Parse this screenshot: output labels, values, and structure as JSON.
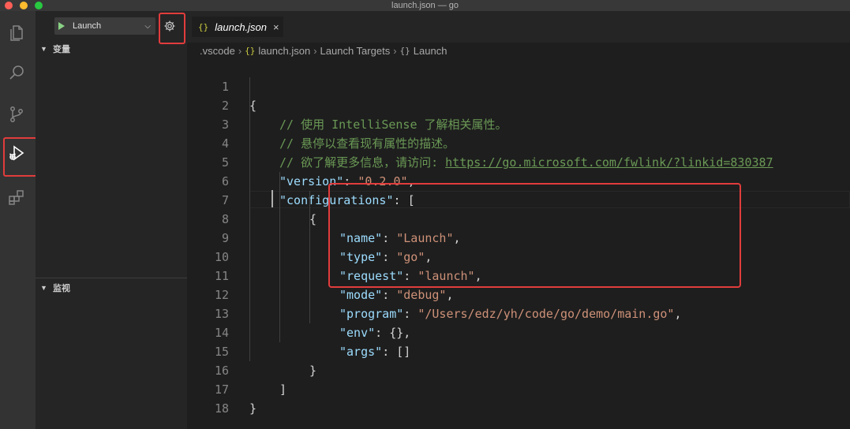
{
  "window": {
    "title": "launch.json — go"
  },
  "activity_bar": {
    "icons": [
      "explorer-icon",
      "search-icon",
      "source-control-icon",
      "run-debug-icon",
      "extensions-icon"
    ]
  },
  "sidebar": {
    "config_name": "Launch",
    "variables_label": "变量",
    "watch_label": "监视"
  },
  "tab": {
    "icon": "{}",
    "label": "launch.json",
    "close": "×"
  },
  "breadcrumb": {
    "folder": ".vscode",
    "file_icon": "{}",
    "file": "launch.json",
    "node1": "Launch Targets",
    "node2_icon": "{}",
    "node2": "Launch"
  },
  "code": {
    "line_numbers": [
      "1",
      "2",
      "3",
      "4",
      "5",
      "6",
      "7",
      "8",
      "9",
      "10",
      "11",
      "12",
      "13",
      "14",
      "15",
      "16",
      "17",
      "18"
    ],
    "l1_brace": "{",
    "l2_comment": "// 使用 IntelliSense 了解相关属性。",
    "l3_comment": "// 悬停以查看现有属性的描述。",
    "l4_comment": "// 欲了解更多信息，请访问: ",
    "l4_url": "https://go.microsoft.com/fwlink/?linkid=830387",
    "version_key": "\"version\"",
    "version_val": "\"0.2.0\"",
    "configurations_key": "\"configurations\"",
    "open_bracket": "[",
    "open_brace": "{",
    "name_key": "\"name\"",
    "name_val": "\"Launch\"",
    "type_key": "\"type\"",
    "type_val": "\"go\"",
    "request_key": "\"request\"",
    "request_val": "\"launch\"",
    "mode_key": "\"mode\"",
    "mode_val": "\"debug\"",
    "program_key": "\"program\"",
    "program_val": "\"/Users/edz/yh/code/go/demo/main.go\"",
    "env_key": "\"env\"",
    "env_val": "{}",
    "args_key": "\"args\"",
    "args_val": "[]",
    "close_brace": "}",
    "close_bracket": "]",
    "final_brace": "}"
  },
  "colors": {
    "key": "#9cdcfe",
    "string": "#ce9178",
    "comment": "#6a9955",
    "highlight_box": "#e23c3c"
  }
}
